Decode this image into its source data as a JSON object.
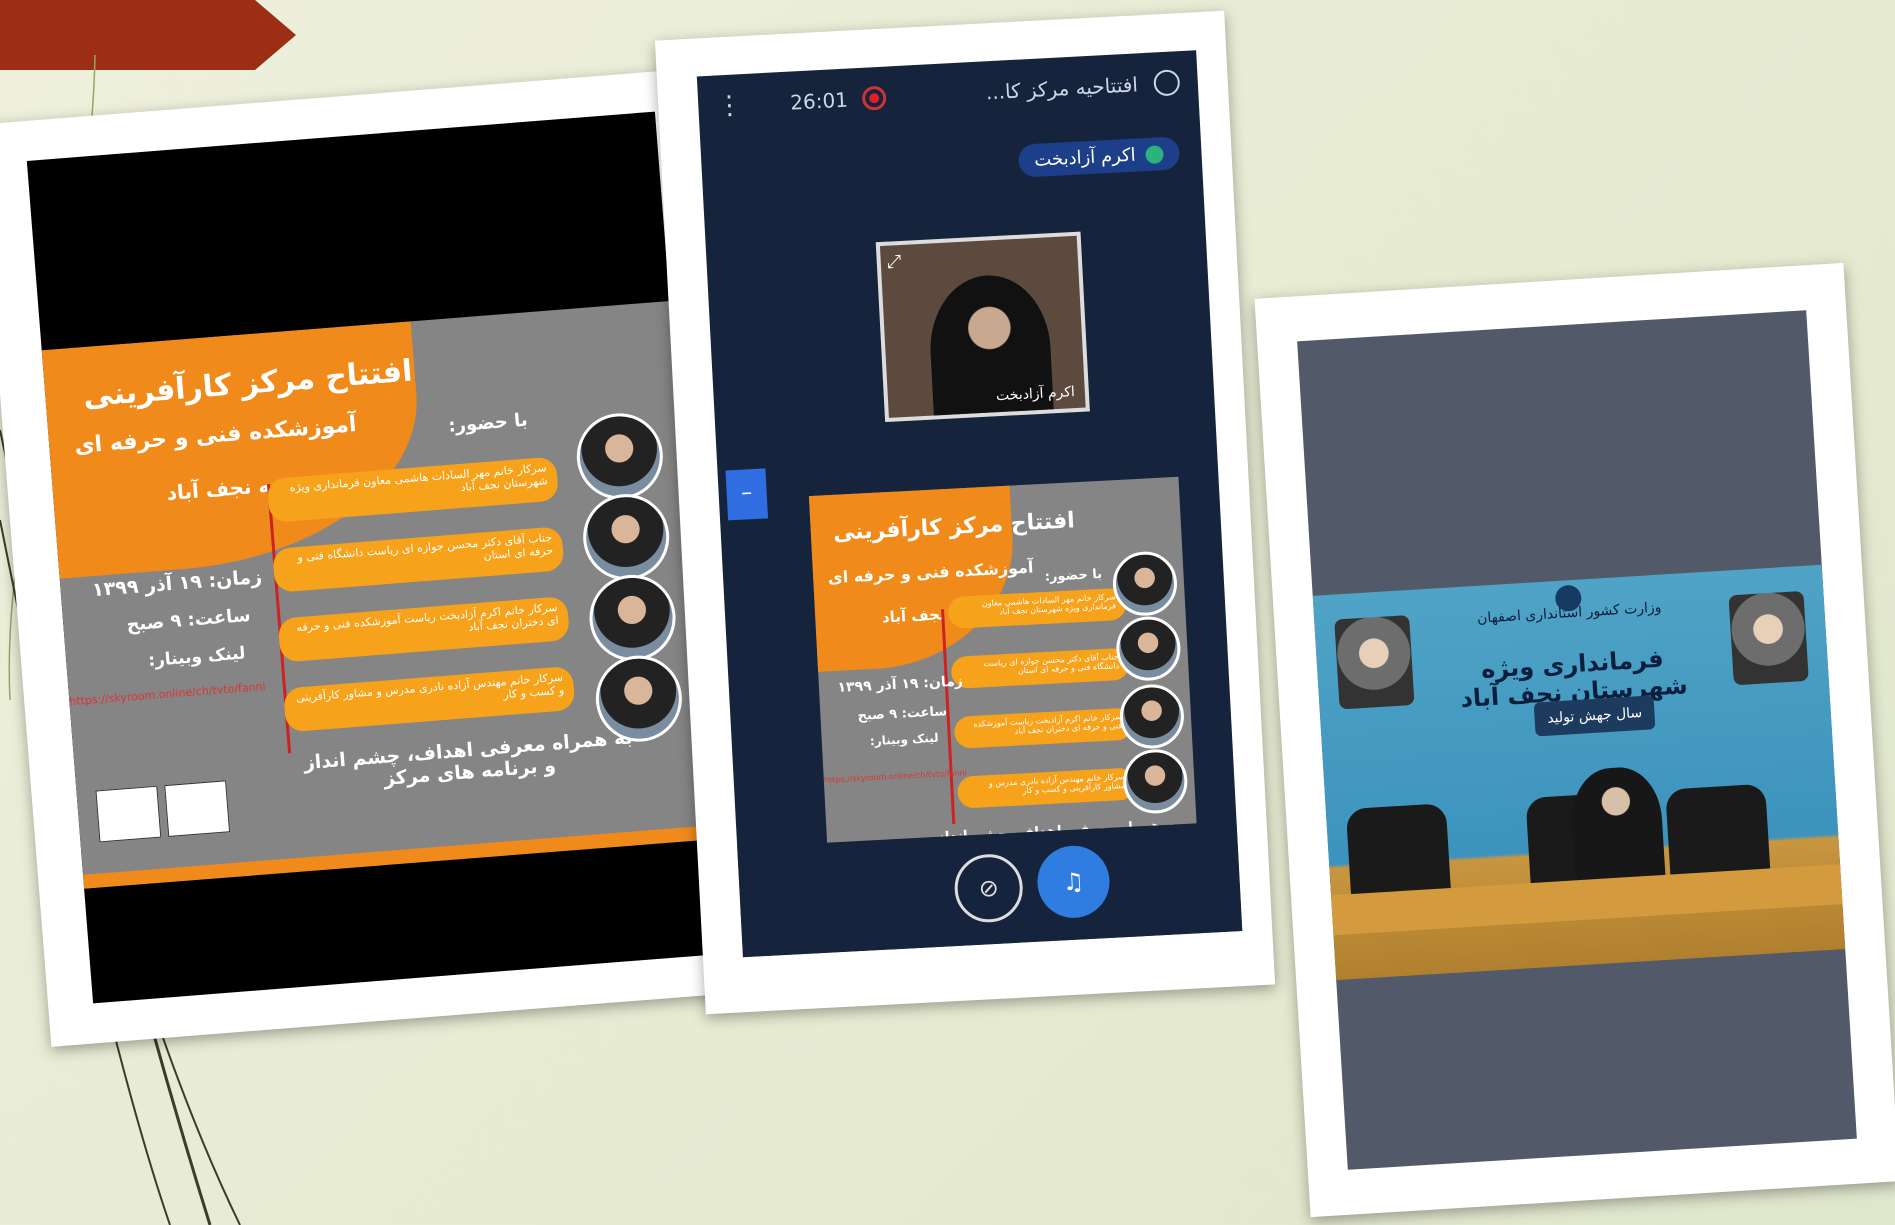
{
  "slide": {
    "accent": "#9b2e14",
    "background": "#e7ebd2"
  },
  "poster": {
    "title": "افتتاح مرکز کارآفرینی",
    "subtitle": "آموزشکده فنی و حرفه ای",
    "city": "سمیه نجف آباد",
    "presence": "با حضور:",
    "speakers": [
      "سرکار خانم مهر السادات هاشمی معاون فرمانداری ویژه شهرستان نجف آباد",
      "جناب آقای دکتر محسن جوازه ای ریاست دانشگاه فنی و حرفه ای استان",
      "سرکار خانم اکرم آزادبخت ریاست آموزشکده فنی و حرفه ای دختران نجف آباد",
      "سرکار خانم مهندس آزاده نادری مدرس و مشاور کارآفرینی و کسب و کار"
    ],
    "date": "زمان: ۱۹ آذر ۱۳۹۹",
    "time": "ساعت: ۹ صبح",
    "link_label": "لینک وبینار:",
    "url": "https://skyroom.online/ch/tvto/fanni",
    "footer_line1": "به همراه معرفی اهداف، چشم انداز",
    "footer_line2": "و برنامه های مرکز"
  },
  "meeting": {
    "timer": "26:01",
    "title": "افتتاحیه مرکز کا...",
    "speaker_name": "اکرم آزادبخت",
    "video_label": "اکرم آزادبخت",
    "icons": [
      "kebab-icon",
      "record-icon",
      "user-icon",
      "mic-icon",
      "expand-icon",
      "camera-off-icon",
      "headphones-icon"
    ]
  },
  "office": {
    "ministry": "وزارت کشور استانداری اصفهان",
    "title": "فرمانداری ویژه شهرستان نجف آباد",
    "year_banner": "سال جهش تولید"
  }
}
